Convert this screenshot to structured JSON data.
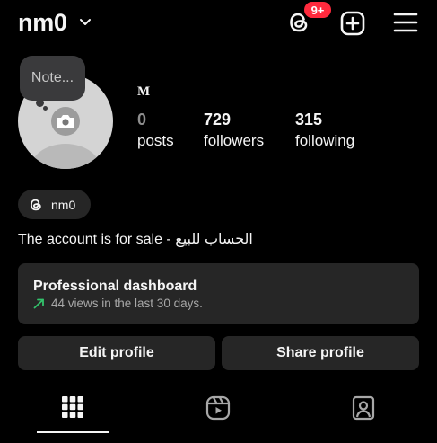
{
  "header": {
    "username": "nm0",
    "notification_badge": "9+",
    "badge_color": "#ff2a3d"
  },
  "note": {
    "placeholder": "Note..."
  },
  "profile": {
    "display_name": "M",
    "stats": {
      "posts": {
        "count": "0",
        "label": "posts"
      },
      "followers": {
        "count": "729",
        "label": "followers"
      },
      "following": {
        "count": "315",
        "label": "following"
      }
    },
    "threads_chip": {
      "label": "nm0",
      "icon": "threads-icon"
    },
    "bio": "The account is for sale - الحساب للبيع"
  },
  "dashboard": {
    "title": "Professional dashboard",
    "subtitle": "44 views in the last 30 days.",
    "trend_color": "#33c26b"
  },
  "actions": {
    "edit_label": "Edit profile",
    "share_label": "Share profile"
  },
  "tabs": [
    {
      "icon": "grid-icon",
      "active": true
    },
    {
      "icon": "reels-icon",
      "active": false
    },
    {
      "icon": "tagged-icon",
      "active": false
    }
  ]
}
